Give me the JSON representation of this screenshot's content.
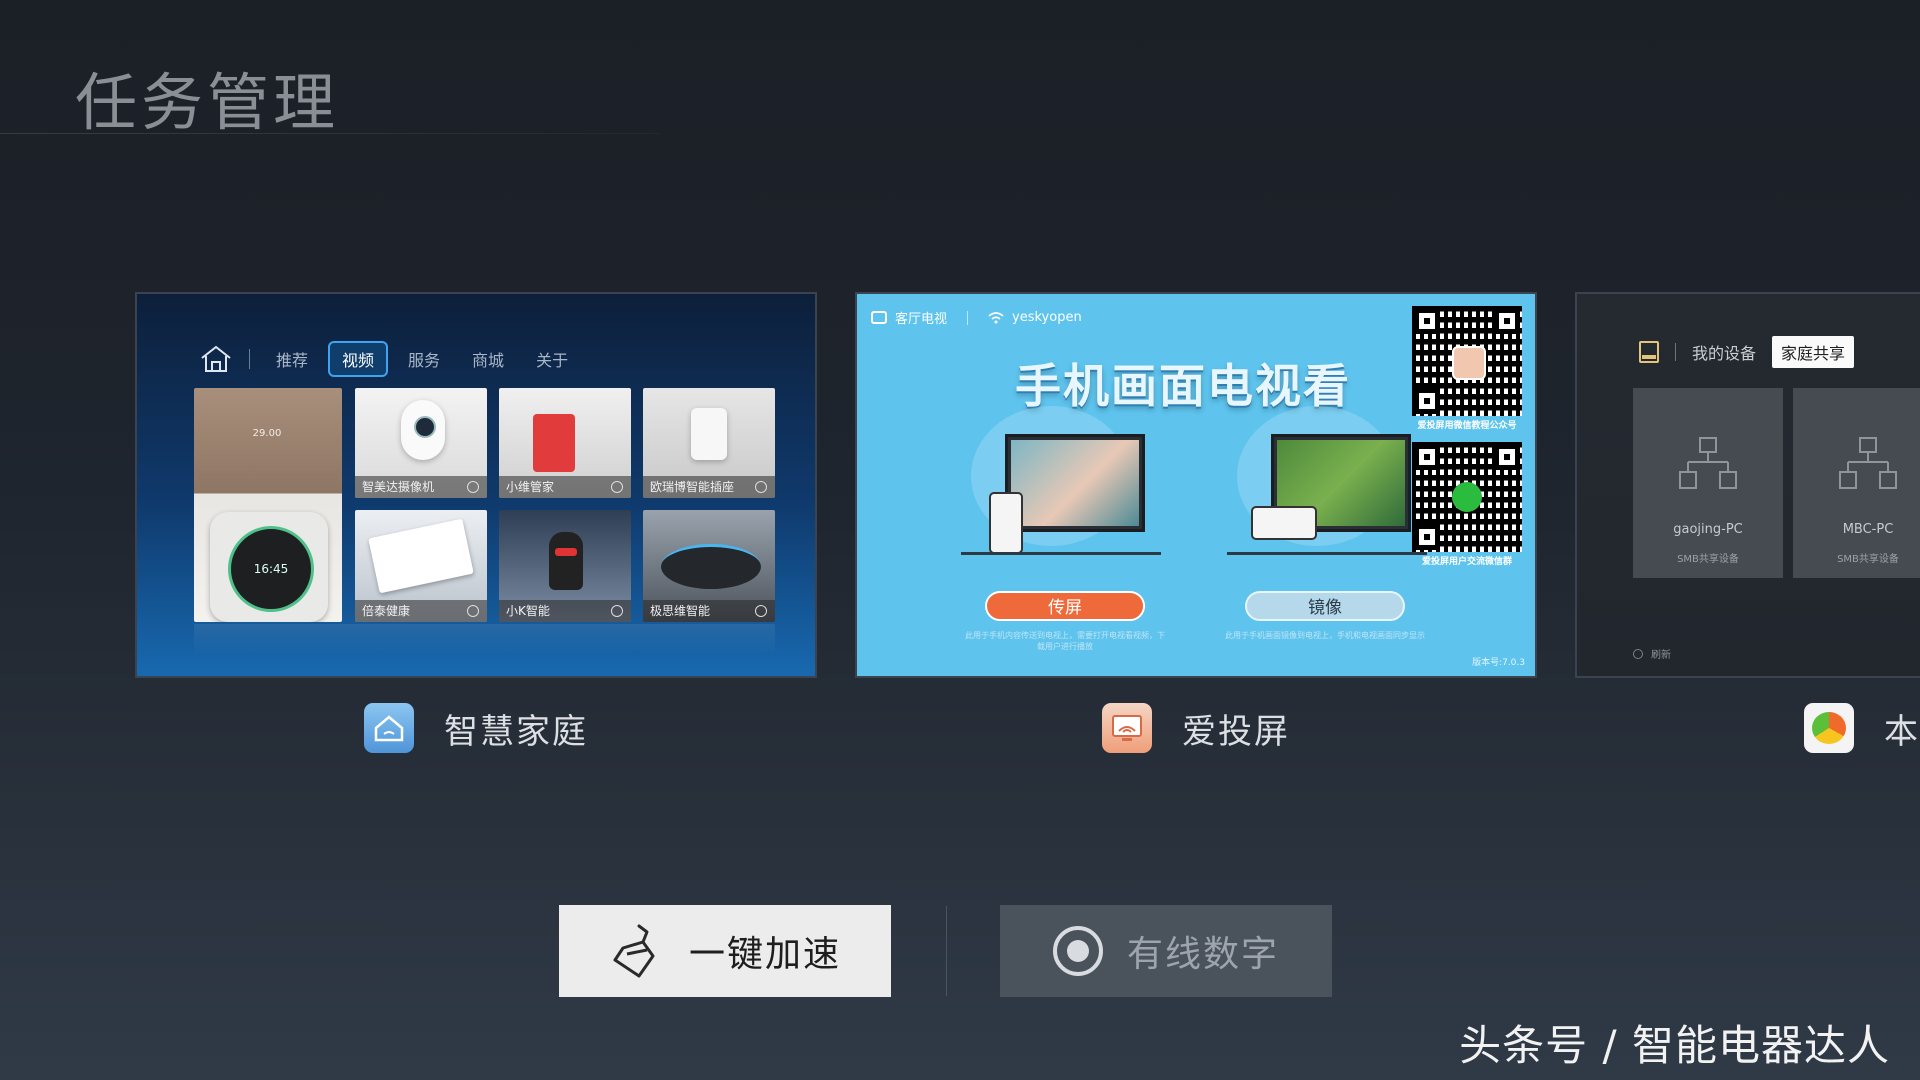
{
  "page": {
    "title": "任务管理"
  },
  "tasks": [
    {
      "app_name": "智慧家庭",
      "preview": {
        "nav_tabs": [
          "推荐",
          "视频",
          "服务",
          "商城",
          "关于"
        ],
        "active_tab": "视频",
        "big_tile": {
          "panel_text": "29.00",
          "thermostat_time": "16:45"
        },
        "tiles": [
          "智美达摄像机",
          "小维管家",
          "欧瑞博智能插座",
          "倍泰健康",
          "小K智能",
          "极思维智能"
        ]
      }
    },
    {
      "app_name": "爱投屏",
      "preview": {
        "room_label": "客厅电视",
        "wifi_name": "yeskyopen",
        "headline": "手机画面电视看",
        "btn_screen": "传屏",
        "btn_mirror": "镜像",
        "desc_left": "此用于手机内容传送到电视上，需要打开电视看视频，下载用户进行播放",
        "desc_right": "此用于手机画面镜像到电视上，手机和电视画面同步显示",
        "qr1_caption": "爱投屏用微信教程公众号",
        "qr2_caption": "爱投屏用户交流微信群",
        "version": "版本号:7.0.3"
      }
    },
    {
      "app_name": "本",
      "preview": {
        "tab_my_devices": "我的设备",
        "tab_family_share": "家庭共享",
        "devices": [
          {
            "name": "gaojing-PC",
            "type": "SMB共享设备"
          },
          {
            "name": "MBC-PC",
            "type": "SMB共享设备"
          }
        ],
        "refresh": "刷新"
      }
    }
  ],
  "actions": {
    "boost_label": "一键加速",
    "wired_label": "有线数字"
  },
  "watermark": "头条号 / 智能电器达人"
}
